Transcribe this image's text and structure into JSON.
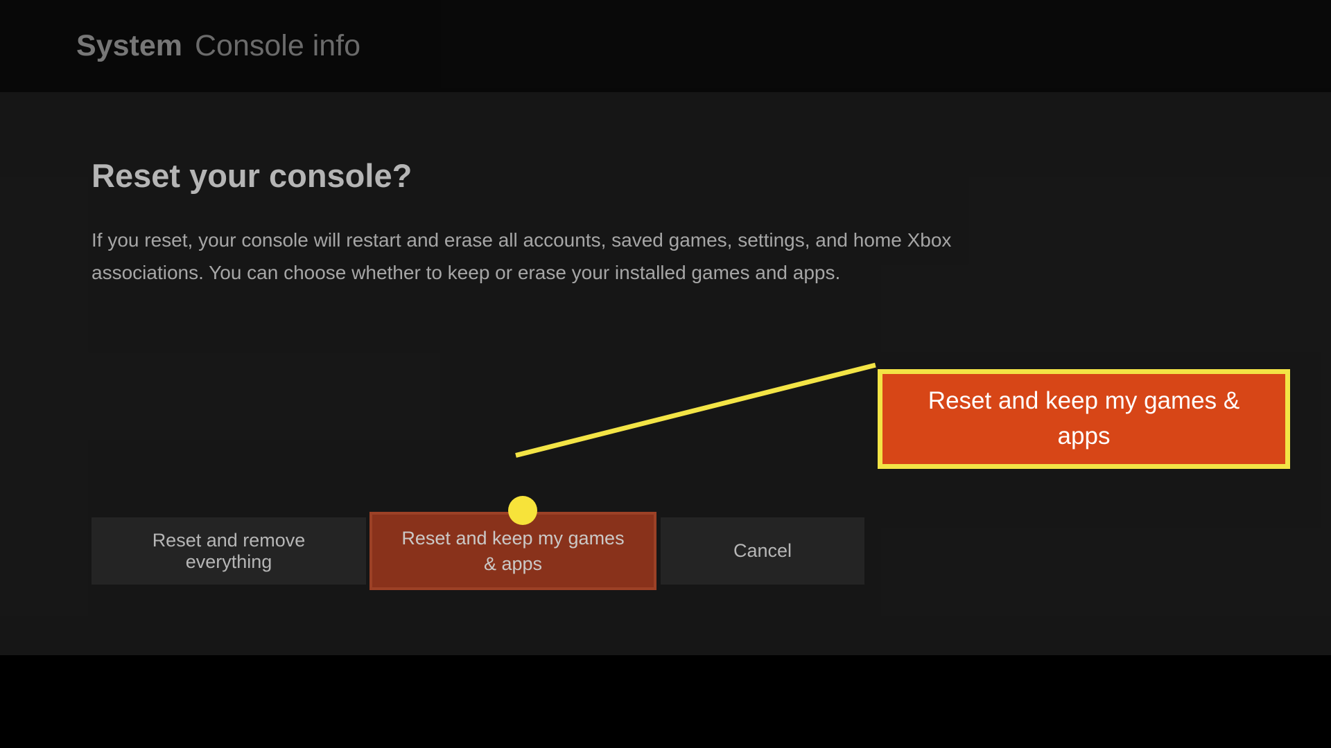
{
  "header": {
    "system_label": "System",
    "subtitle": "Console info"
  },
  "dialog": {
    "title": "Reset your console?",
    "body": "If you reset, your console will restart and erase all accounts, saved games, settings, and home Xbox associations. You can choose whether to keep or erase your installed games and apps."
  },
  "buttons": {
    "reset_remove": "Reset and remove everything",
    "reset_keep": "Reset and keep my games & apps",
    "cancel": "Cancel"
  },
  "callout": {
    "text": "Reset and keep my games & apps"
  },
  "colors": {
    "highlight_bg": "#d74617",
    "highlight_border": "#f3e446",
    "selected_bg": "#9c3a1f"
  }
}
